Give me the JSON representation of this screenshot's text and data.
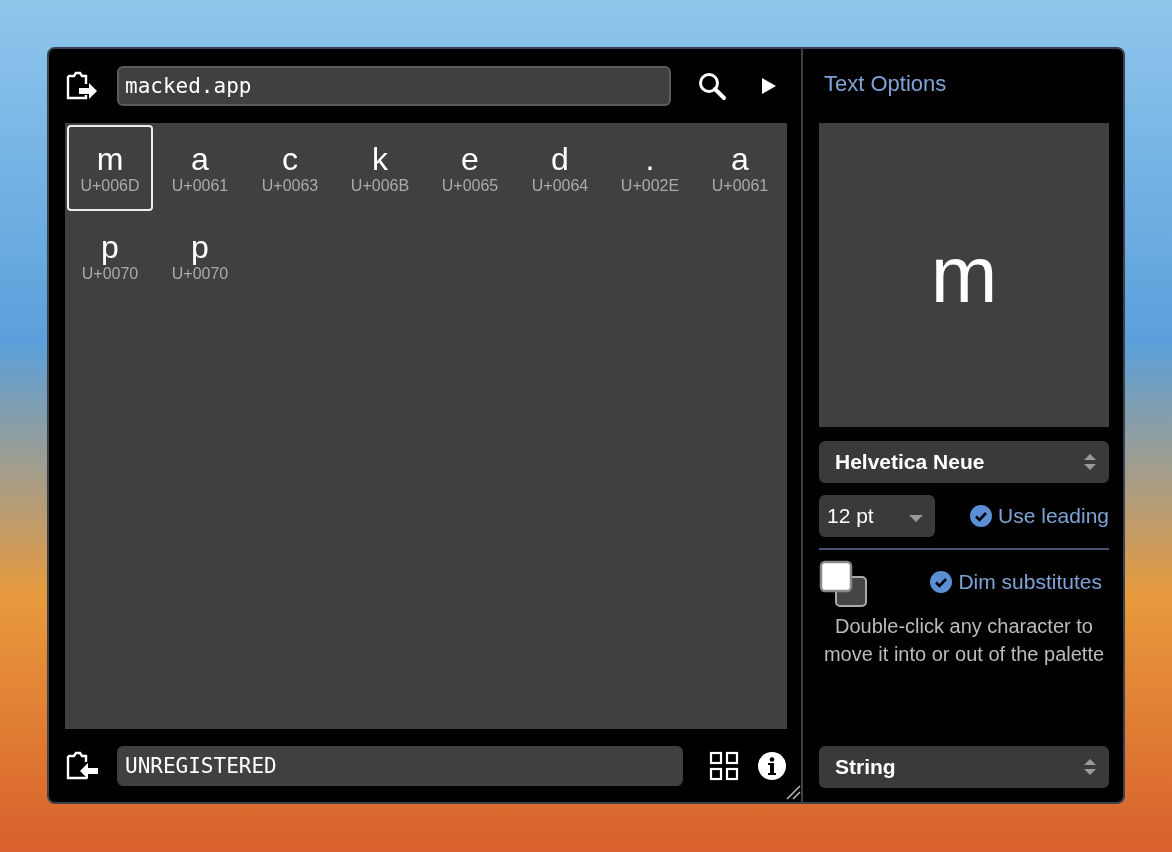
{
  "search_field": {
    "value": "macked.app"
  },
  "glyphs": [
    {
      "char": "m",
      "code": "U+006D",
      "selected": true
    },
    {
      "char": "a",
      "code": "U+0061",
      "selected": false
    },
    {
      "char": "c",
      "code": "U+0063",
      "selected": false
    },
    {
      "char": "k",
      "code": "U+006B",
      "selected": false
    },
    {
      "char": "e",
      "code": "U+0065",
      "selected": false
    },
    {
      "char": "d",
      "code": "U+0064",
      "selected": false
    },
    {
      "char": ".",
      "code": "U+002E",
      "selected": false
    },
    {
      "char": "a",
      "code": "U+0061",
      "selected": false
    },
    {
      "char": "p",
      "code": "U+0070",
      "selected": false
    },
    {
      "char": "p",
      "code": "U+0070",
      "selected": false
    }
  ],
  "bottom_field": {
    "value": "UNREGISTERED"
  },
  "text_options": {
    "title": "Text Options",
    "preview": "m",
    "font": "Helvetica Neue",
    "size": "12 pt",
    "use_leading": {
      "label": "Use leading",
      "checked": true
    },
    "dim_substitutes": {
      "label": "Dim substitutes",
      "checked": true
    },
    "hint": "Double-click any character to move it into or out of the palette",
    "mode": "String"
  }
}
